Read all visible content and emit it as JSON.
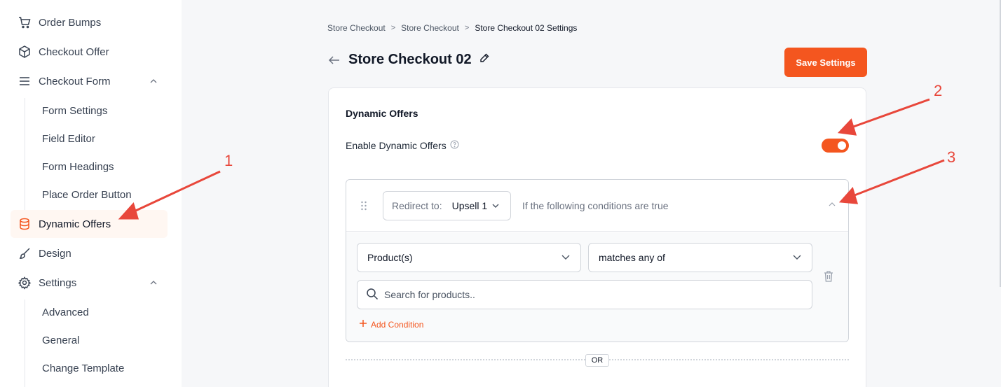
{
  "sidebar": {
    "items": [
      {
        "label": "Order Bumps",
        "icon": "cart-icon"
      },
      {
        "label": "Checkout Offer",
        "icon": "box-icon"
      },
      {
        "label": "Checkout Form",
        "icon": "menu-icon"
      },
      {
        "label": "Dynamic Offers",
        "icon": "database-icon"
      },
      {
        "label": "Design",
        "icon": "brush-icon"
      },
      {
        "label": "Settings",
        "icon": "gear-icon"
      }
    ],
    "checkout_form_subitems": [
      "Form Settings",
      "Field Editor",
      "Form Headings",
      "Place Order Button"
    ],
    "settings_subitems": [
      "Advanced",
      "General",
      "Change Template"
    ],
    "active_item": "Dynamic Offers"
  },
  "breadcrumb": {
    "items": [
      "Store Checkout",
      "Store Checkout",
      "Store Checkout 02 Settings"
    ],
    "separator": ">"
  },
  "header": {
    "title": "Store Checkout 02",
    "save_label": "Save Settings"
  },
  "dynamic_offers": {
    "card_title": "Dynamic Offers",
    "enable_label": "Enable Dynamic Offers",
    "enabled": true,
    "rule": {
      "redirect_label": "Redirect to:",
      "redirect_value": "Upsell 1",
      "condition_text": "If the following conditions are true",
      "field_select": "Product(s)",
      "operator_select": "matches any of",
      "search_placeholder": "Search for products..",
      "add_condition_label": "Add Condition"
    },
    "or_label": "OR"
  },
  "annotations": [
    "1",
    "2",
    "3"
  ],
  "colors": {
    "accent": "#f4561f",
    "annotation": "#e8473b",
    "active_bg": "#fff7f2"
  }
}
